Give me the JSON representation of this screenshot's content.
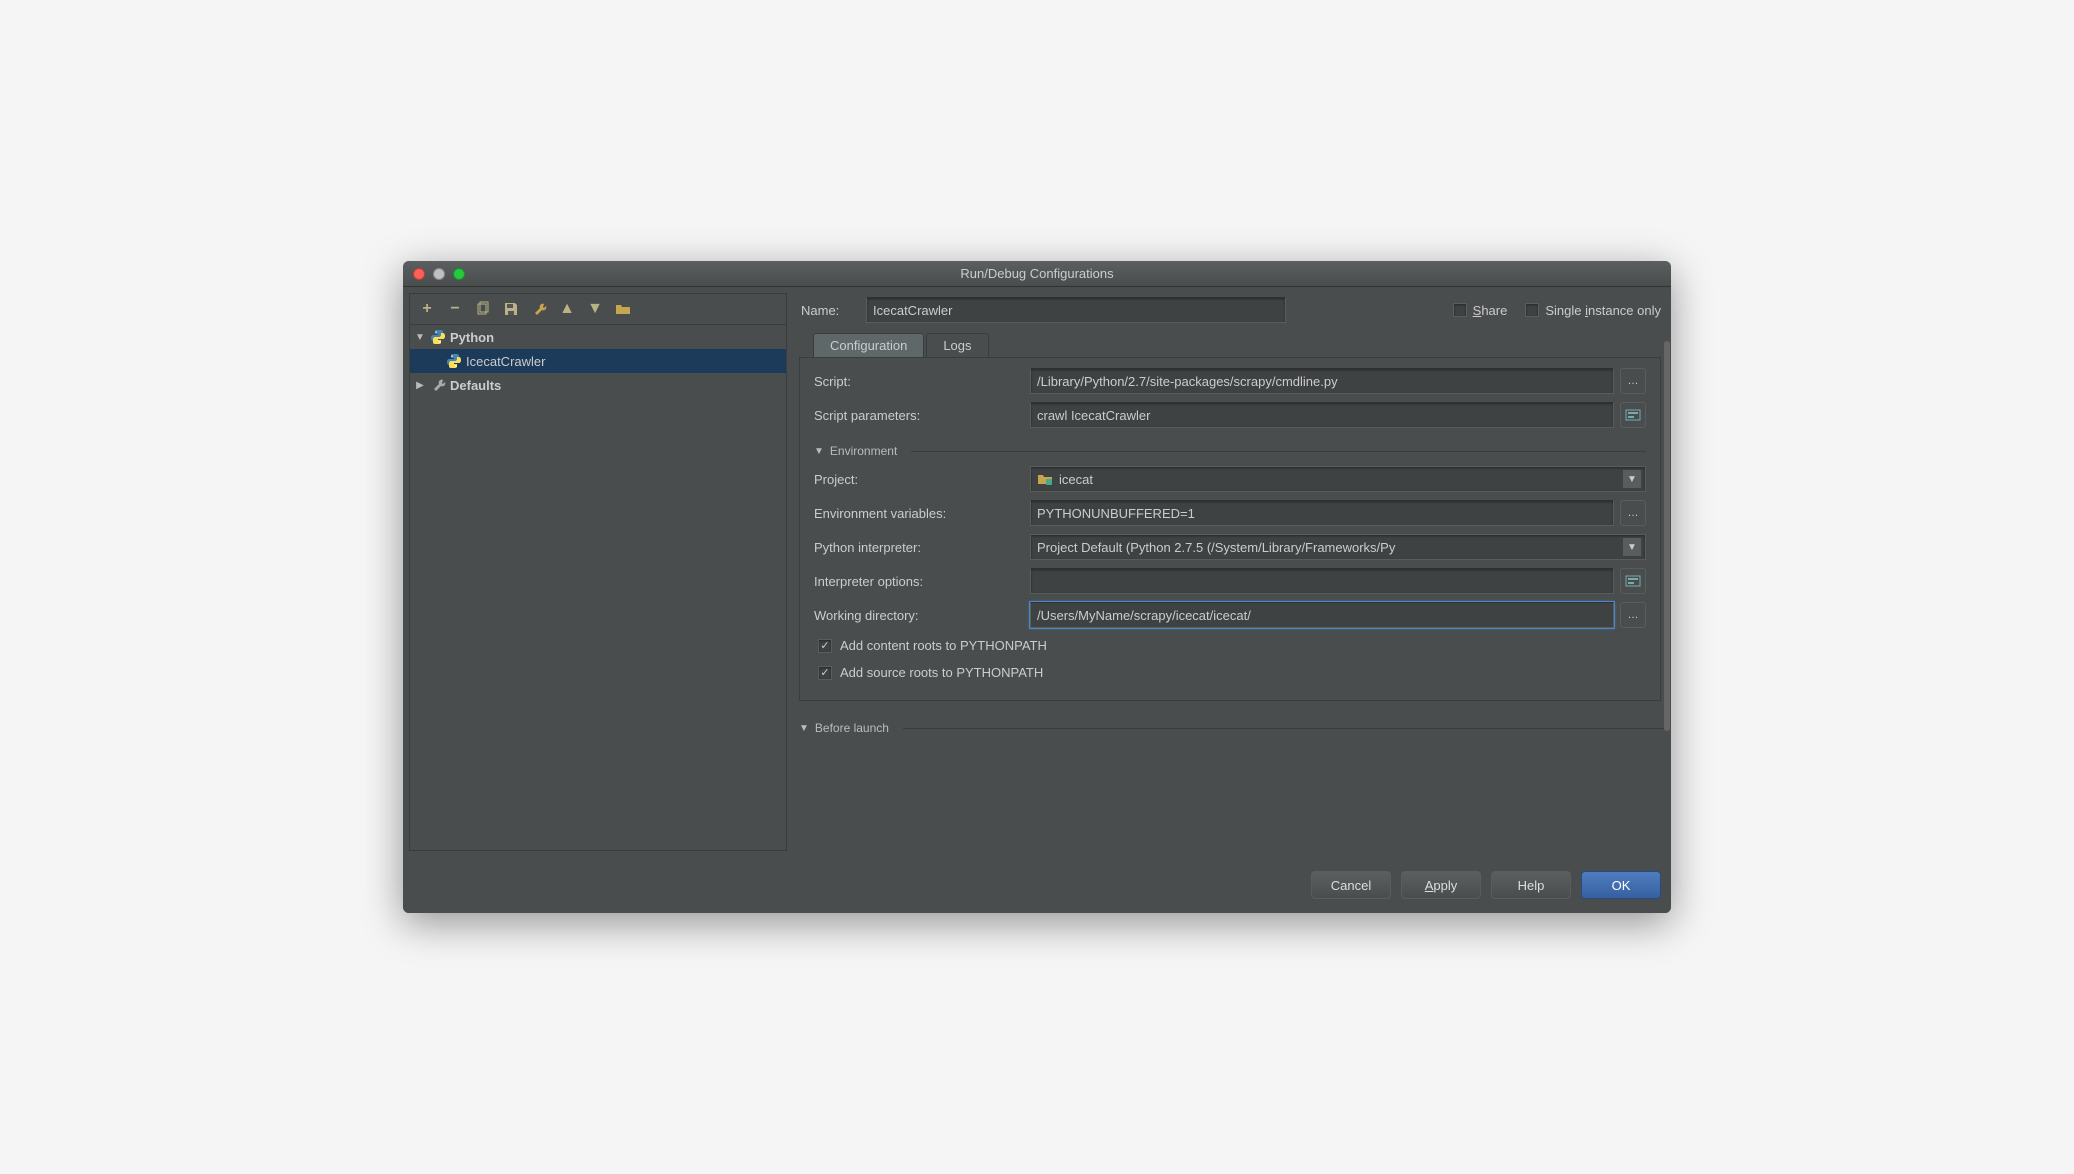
{
  "window": {
    "title": "Run/Debug Configurations"
  },
  "sidebar": {
    "tree": {
      "python": {
        "label": "Python"
      },
      "crawler": {
        "label": "IcecatCrawler"
      },
      "defaults": {
        "label": "Defaults"
      }
    }
  },
  "form": {
    "name_label": "Name:",
    "name_value": "IcecatCrawler",
    "share_label": "Share",
    "single_instance_label": "Single instance only",
    "tabs": {
      "configuration": "Configuration",
      "logs": "Logs"
    },
    "script_label": "Script:",
    "script_value": "/Library/Python/2.7/site-packages/scrapy/cmdline.py",
    "script_params_label": "Script parameters:",
    "script_params_value": "crawl IcecatCrawler",
    "environment_section": "Environment",
    "project_label": "Project:",
    "project_value": "icecat",
    "envvars_label": "Environment variables:",
    "envvars_value": "PYTHONUNBUFFERED=1",
    "interpreter_label": "Python interpreter:",
    "interpreter_value": "Project Default (Python 2.7.5 (/System/Library/Frameworks/Py",
    "interp_options_label": "Interpreter options:",
    "interp_options_value": "",
    "workdir_label": "Working directory:",
    "workdir_value": "/Users/MyName/scrapy/icecat/icecat/",
    "content_roots_label": "Add content roots to PYTHONPATH",
    "source_roots_label": "Add source roots to PYTHONPATH",
    "before_launch_label": "Before launch"
  },
  "buttons": {
    "cancel": "Cancel",
    "apply": "Apply",
    "help": "Help",
    "ok": "OK"
  }
}
